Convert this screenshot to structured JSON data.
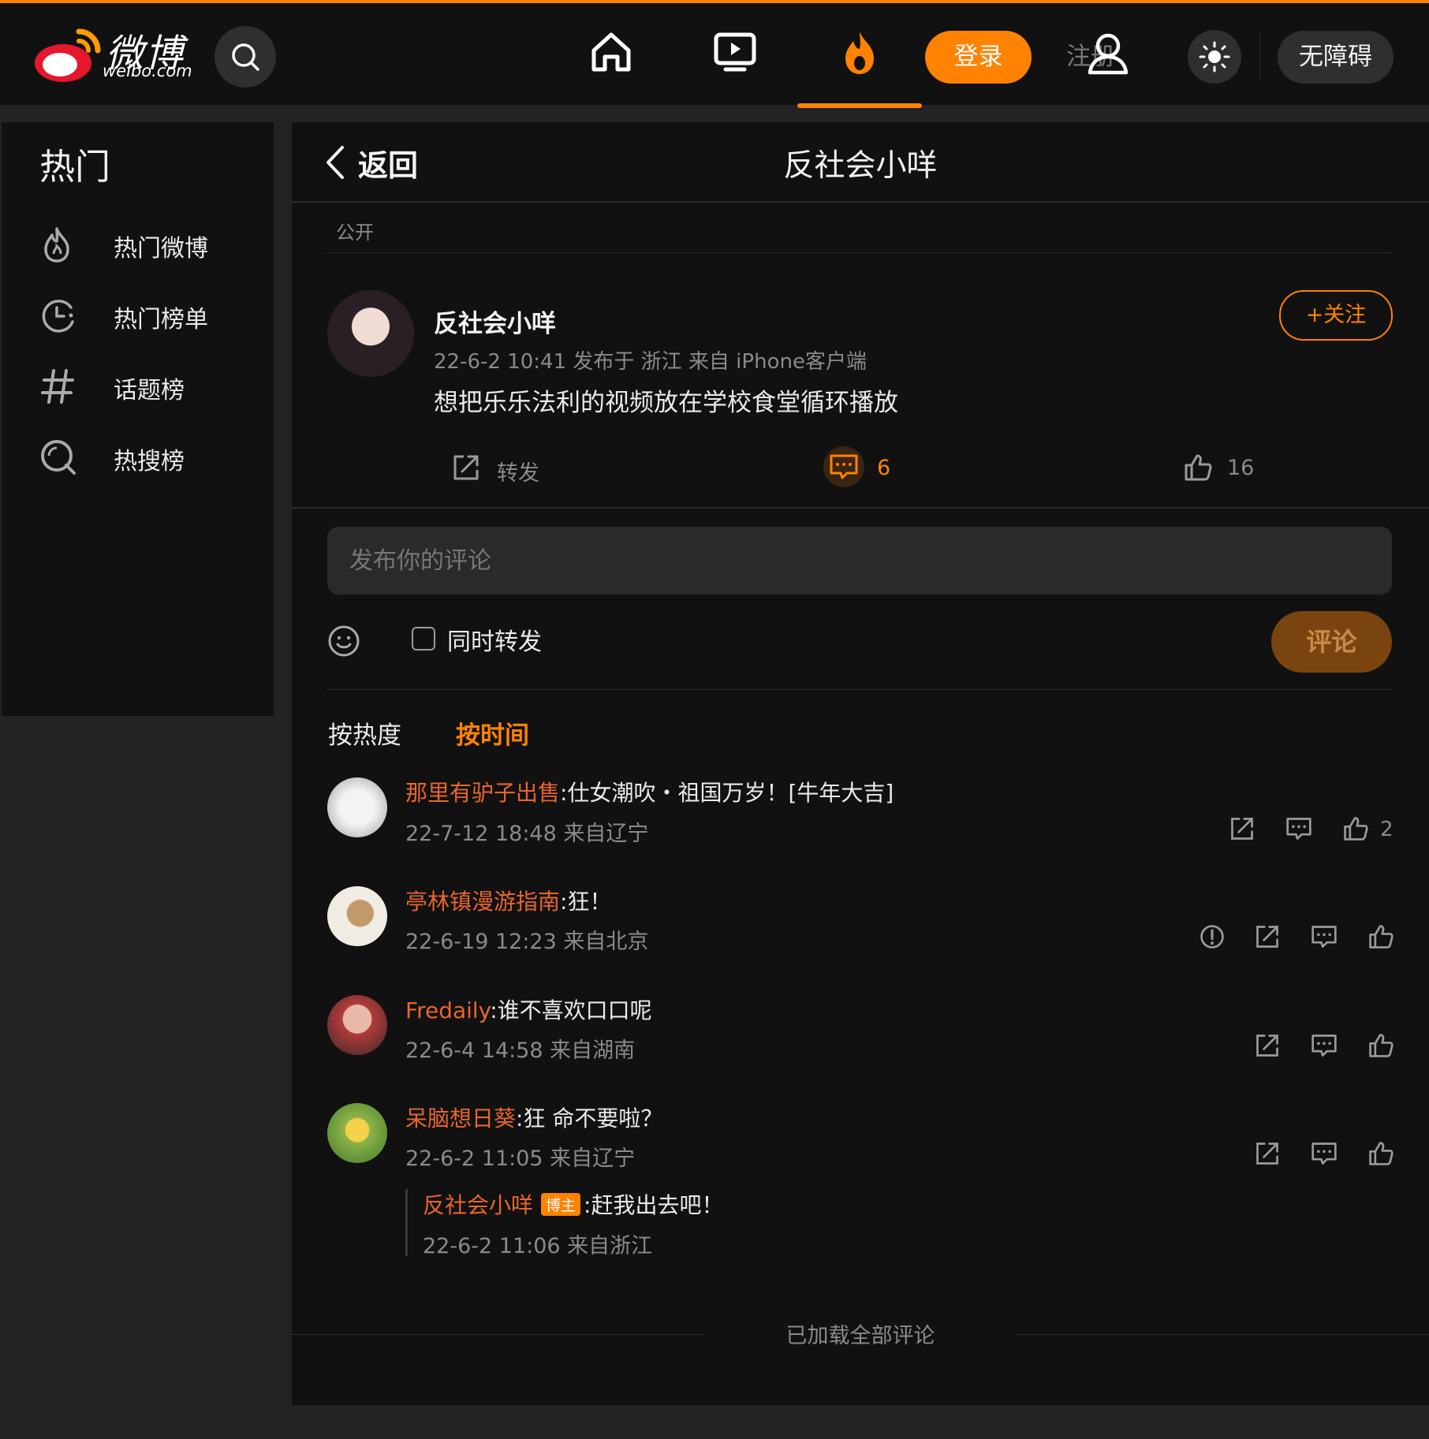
{
  "header": {
    "logo_text": "微博",
    "logo_sub": "weibo.com",
    "login_label": "登录",
    "register_label": "注册",
    "accessibility_label": "无障碍"
  },
  "colors": {
    "accent": "#ff8200",
    "username": "#e8652d",
    "background": "#111112"
  },
  "sidebar": {
    "title": "热门",
    "items": [
      {
        "label": "热门微博",
        "icon": "flame-icon"
      },
      {
        "label": "热门榜单",
        "icon": "clock-rank-icon"
      },
      {
        "label": "话题榜",
        "icon": "hashtag-icon"
      },
      {
        "label": "热搜榜",
        "icon": "search-rank-icon"
      }
    ]
  },
  "detail": {
    "back_label": "返回",
    "title": "反社会小咩",
    "visibility": "公开",
    "author": {
      "name": "反社会小咩",
      "meta": "22-6-2 10:41  发布于 浙江  来自 iPhone客户端",
      "follow_label": "+关注"
    },
    "post_text": "想把乐乐法利的视频放在学校食堂循环播放",
    "actions": {
      "repost_label": "转发",
      "comment_count": "6",
      "like_count": "16"
    }
  },
  "comment_form": {
    "placeholder": "发布你的评论",
    "repost_also_label": "同时转发",
    "submit_label": "评论"
  },
  "sort": {
    "hot_label": "按热度",
    "time_label": "按时间",
    "active": "按时间"
  },
  "comments": [
    {
      "user": "那里有驴子出售",
      "text": ":仕女潮吹・祖国万岁！[牛年大吉]",
      "meta": "22-7-12 18:48 来自辽宁",
      "likes": "2"
    },
    {
      "user": "亭林镇漫游指南",
      "text": ":狂！",
      "meta": "22-6-19 12:23 来自北京"
    },
    {
      "user": "Fredaily",
      "text": ":谁不喜欢口口呢",
      "meta": "22-6-4 14:58 来自湖南"
    },
    {
      "user": "呆脑想日葵",
      "text": ":狂 命不要啦？",
      "meta": "22-6-2 11:05 来自辽宁",
      "reply": {
        "user": "反社会小咩",
        "badge": "博主",
        "text": ":赶我出去吧！",
        "meta": "22-6-2 11:06 来自浙江"
      }
    }
  ],
  "footer": {
    "all_loaded": "已加载全部评论"
  }
}
